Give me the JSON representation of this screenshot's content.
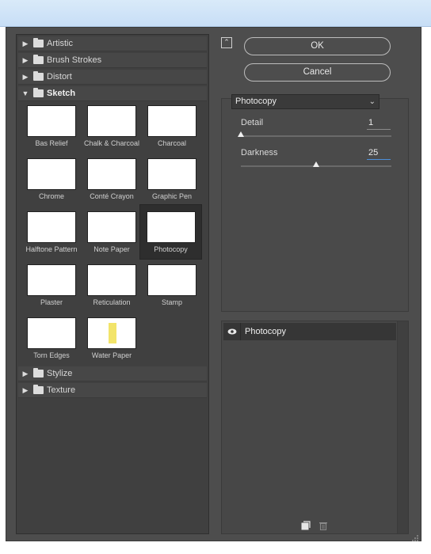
{
  "gallery": {
    "categories_top": [
      {
        "label": "Artistic",
        "open": false
      },
      {
        "label": "Brush Strokes",
        "open": false
      },
      {
        "label": "Distort",
        "open": false
      },
      {
        "label": "Sketch",
        "open": true
      }
    ],
    "categories_bottom": [
      {
        "label": "Stylize",
        "open": false
      },
      {
        "label": "Texture",
        "open": false
      }
    ],
    "sketch_filters": [
      {
        "label": "Bas Relief"
      },
      {
        "label": "Chalk & Charcoal"
      },
      {
        "label": "Charcoal"
      },
      {
        "label": "Chrome"
      },
      {
        "label": "Conté Crayon"
      },
      {
        "label": "Graphic Pen"
      },
      {
        "label": "Halftone Pattern"
      },
      {
        "label": "Note Paper"
      },
      {
        "label": "Photocopy",
        "selected": true
      },
      {
        "label": "Plaster"
      },
      {
        "label": "Reticulation"
      },
      {
        "label": "Stamp"
      },
      {
        "label": "Torn Edges"
      },
      {
        "label": "Water Paper"
      }
    ]
  },
  "buttons": {
    "ok": "OK",
    "cancel": "Cancel"
  },
  "settings": {
    "filter_select": "Photocopy",
    "params": [
      {
        "label": "Detail",
        "value": "1",
        "level": 0.0
      },
      {
        "label": "Darkness",
        "value": "25",
        "level": 0.5
      }
    ]
  },
  "layers": {
    "items": [
      {
        "name": "Photocopy",
        "visible": true
      }
    ]
  },
  "icons": {
    "collapse": "collapse-panel-icon",
    "eye": "eye-icon",
    "new_layer": "new-effect-layer-icon",
    "delete": "trash-icon",
    "folder": "folder-icon"
  }
}
